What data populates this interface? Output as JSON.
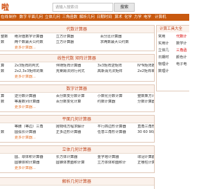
{
  "header": {
    "logo": "啦",
    "search_placeholder": "请输入搜索词",
    "search_button": "搜索"
  },
  "nav": [
    "在线",
    "制作",
    "数字",
    "平面几何",
    "立体几何",
    "三角函数",
    "解析几何",
    "日期时间",
    "算术",
    "化学",
    "力学",
    "电学",
    "计算机"
  ],
  "sections": {
    "s1": {
      "title": "代数计算器",
      "rows": [
        [
          "整数",
          "绝对值数字计算器",
          "立方计算器",
          "百分比计算器"
        ],
        [
          "数",
          "两个数最大公约数",
          "立方计算器",
          "求两数最大公约数"
        ],
        [
          "",
          "更多计算器...",
          "",
          ""
        ]
      ],
      "more": "更多计算器..."
    },
    "s2": {
      "title": "线性代数 矩阵计算器",
      "rows": [
        [
          "算",
          "2x3矩阵的判式",
          "伴随矩阵计算器",
          "3x3矩阵逆矩阵",
          "N*N矩阵数的标准"
        ],
        [
          "数",
          "2x2,3x3矩阵的乘",
          "克莱姆法则行列式",
          "高斯消元法矩阵",
          "2x2矩阵单位计算"
        ],
        [
          "",
          "更多计算器...",
          "",
          "",
          ""
        ]
      ]
    },
    "s3": {
      "title": "数字计算器",
      "rows": [
        [
          "算",
          "逆分数计算器",
          "百分数变分数计算",
          "小数化分数计算",
          "整数乘方计算器"
        ],
        [
          "数",
          "等差数列计算器",
          "百分数变化计算",
          "约数计算器",
          "分数计算器"
        ],
        [
          "",
          "更多计算器...",
          "",
          "",
          ""
        ]
      ]
    },
    "s4": {
      "title": "平面几何计算器",
      "rows": [
        [
          "",
          "等腰（等边）三角",
          "抛物线方程求解计",
          "平行四边形计算器",
          "直角三角形（勾股"
        ],
        [
          "数",
          "圆弧长计算器",
          "正多边形计算器",
          "任意三角形计算器",
          "30 60 90度直角三"
        ],
        [
          "",
          "更多计算器...",
          "",
          "",
          ""
        ]
      ]
    },
    "s5": {
      "title": "立体几何计算器",
      "rows": [
        [
          "",
          "圆、球体积计算器",
          "长方体计算器",
          "金字塔计算器",
          "球冠计算器"
        ],
        [
          "",
          "圆锥体积计算器",
          "圆锥体表面积计算",
          "立方体体积面积计",
          "正棱柱计算器"
        ],
        [
          "",
          "更多计算器...",
          "",
          "",
          ""
        ]
      ]
    },
    "s6": {
      "title": "解析几何计算器"
    }
  },
  "side": {
    "title": "计算工具大全",
    "col1": [
      "常用",
      "实用计",
      "立体几",
      "日期时",
      "物理计",
      "数理计"
    ],
    "col2": [
      "代数计",
      "数学计",
      "三角函",
      "颜色计",
      "电子电",
      ""
    ]
  }
}
